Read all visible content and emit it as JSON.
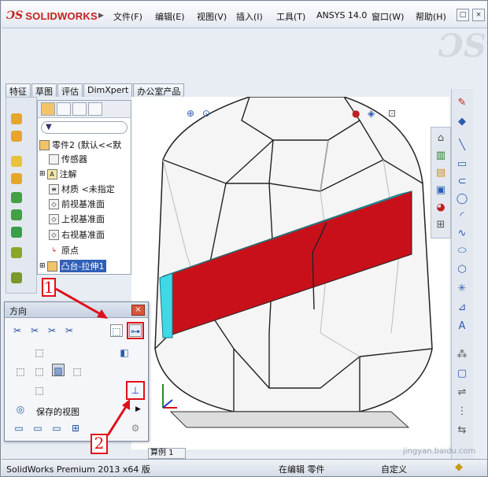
{
  "app": {
    "logo_text": "SOLIDWORKS",
    "menu": [
      "文件(F)",
      "编辑(E)",
      "视图(V)",
      "插入(I)",
      "工具(T)",
      "ANSYS 14.0",
      "窗口(W)",
      "帮助(H)"
    ],
    "window_buttons": [
      "–",
      "□",
      "×"
    ]
  },
  "command_tabs": [
    "特征",
    "草图",
    "评估",
    "DimXpert",
    "办公室产品"
  ],
  "feature_tree": {
    "root": "零件2 (默认<<默",
    "items": [
      "传感器",
      "注解",
      "材质 <未指定",
      "前视基准面",
      "上视基准面",
      "右视基准面",
      "原点",
      "凸台-拉伸1"
    ],
    "selected": "凸台-拉伸1"
  },
  "orientation_dialog": {
    "title": "方向",
    "saved_views": "保存的视图"
  },
  "annotations": {
    "callout_1": "1",
    "callout_2": "2"
  },
  "bottom_tab": "算例 1",
  "status": {
    "product": "SolidWorks Premium 2013 x64 版",
    "state": "在编辑 零件",
    "units": "自定义",
    "watermark": "jingyan.baidu.com"
  },
  "colors": {
    "accent_red": "#e0101a",
    "part_red": "#c8101a",
    "part_cyan": "#3fd8e6",
    "selection_blue": "#2f5fb7"
  }
}
